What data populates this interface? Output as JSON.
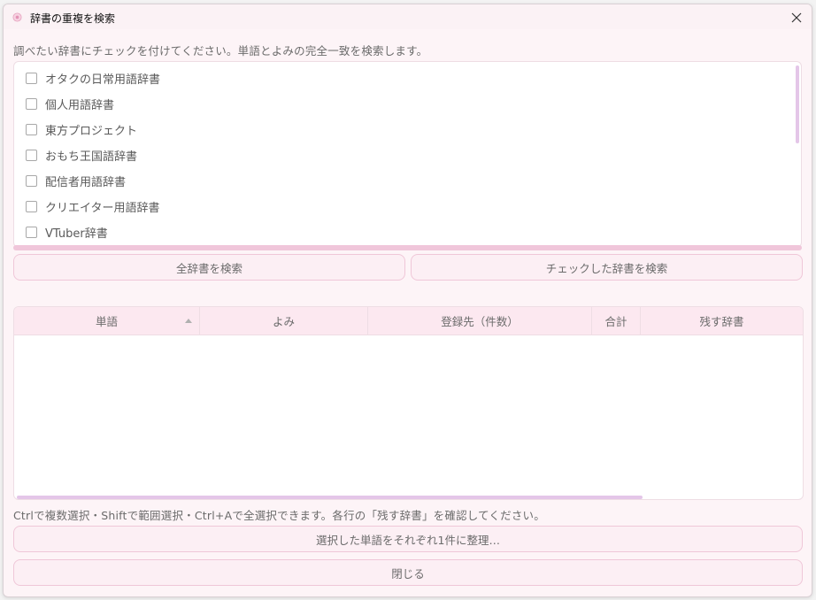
{
  "window": {
    "title": "辞書の重複を検索",
    "close_glyph": "✕"
  },
  "instruction": "調べたい辞書にチェックを付けてください。単語とよみの完全一致を検索します。",
  "dictionaries": [
    {
      "label": "オタクの日常用語辞書",
      "checked": false
    },
    {
      "label": "個人用語辞書",
      "checked": false
    },
    {
      "label": "東方プロジェクト",
      "checked": false
    },
    {
      "label": "おもち王国語辞書",
      "checked": false
    },
    {
      "label": "配信者用語辞書",
      "checked": false
    },
    {
      "label": "クリエイター用語辞書",
      "checked": false
    },
    {
      "label": "VTuber辞書",
      "checked": false
    }
  ],
  "buttons": {
    "search_all": "全辞書を検索",
    "search_checked": "チェックした辞書を検索",
    "organize": "選択した単語をそれぞれ1件に整理…",
    "close": "閉じる"
  },
  "table": {
    "columns": [
      "単語",
      "よみ",
      "登録先（件数）",
      "合計",
      "残す辞書"
    ],
    "sorted_column": "単語",
    "sort_direction": "ascending",
    "rows": []
  },
  "hint": "Ctrlで複数選択・Shiftで範囲選択・Ctrl+Aで全選択できます。各行の「残す辞書」を確認してください。",
  "colors": {
    "window_bg": "#fdf4f7",
    "button_bg": "#fceff4",
    "button_border": "#efc7d8",
    "header_bg": "#fce8f0",
    "scrollbar": "#e4c6e8"
  },
  "icons": {
    "title": "app-flower-icon",
    "close": "close-icon"
  }
}
